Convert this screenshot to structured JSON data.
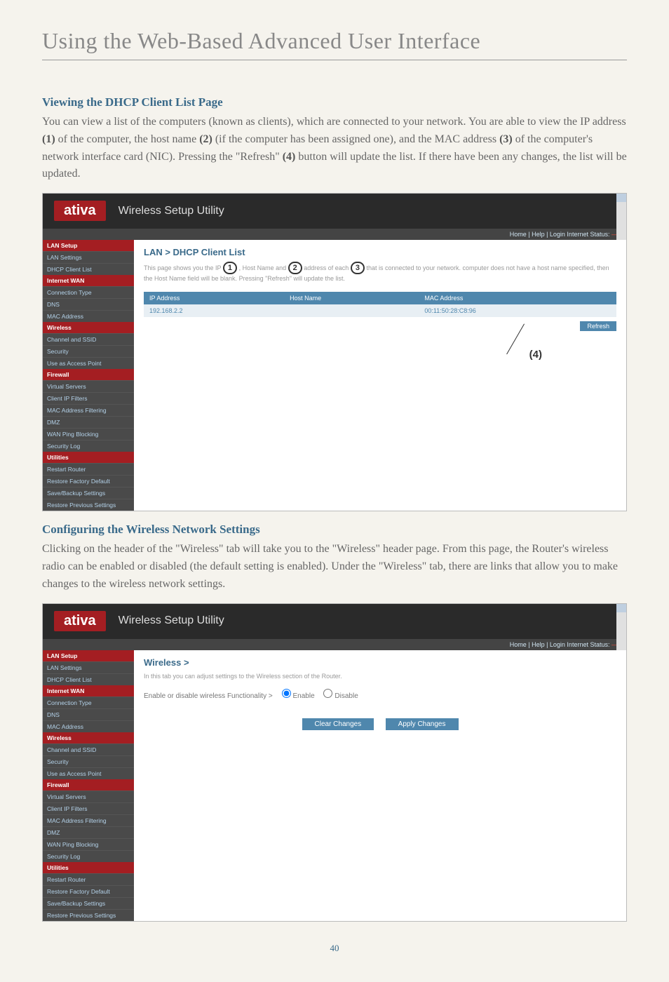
{
  "page_title": "Using the Web-Based Advanced User Interface",
  "section1": {
    "heading": "Viewing the DHCP Client List Page",
    "body_parts": [
      "You can view a list of the computers (known as clients), which are connected to your network. You are able to view the IP address ",
      "(1)",
      " of the computer, the host name ",
      "(2)",
      " (if the computer has been assigned one), and the MAC address ",
      "(3)",
      " of the computer's network interface card (NIC). Pressing the \"Refresh\" ",
      "(4)",
      " button will update the list. If there have been any changes, the list will be updated."
    ]
  },
  "screenshot1": {
    "brand": "ativa",
    "brand_sub": "Wireless Setup Utility",
    "meta": "Home | Help | Login  Internet Status:",
    "panel_title": "LAN > DHCP Client List",
    "panel_desc_a": "This page shows you the IP",
    "panel_desc_b": ", Host Name and",
    "panel_desc_c": "address of each",
    "panel_desc_d": "that is connected to your network.",
    "panel_desc_e": " computer does not have a host name specified, then the Host Name field will be blank. Pressing \"Refresh\" will update the list.",
    "table": {
      "headers": [
        "IP Address",
        "Host Name",
        "MAC Address"
      ],
      "row": [
        "192.168.2.2",
        "",
        "00:11:50:28:C8:96"
      ]
    },
    "refresh": "Refresh",
    "callout4": "(4)",
    "sidebar": {
      "groups": [
        {
          "head": "LAN Setup",
          "items": [
            "LAN Settings",
            "DHCP Client List"
          ]
        },
        {
          "head": "Internet WAN",
          "items": [
            "Connection Type",
            "DNS",
            "MAC Address"
          ]
        },
        {
          "head": "Wireless",
          "items": [
            "Channel and SSID",
            "Security",
            "Use as Access Point"
          ]
        },
        {
          "head": "Firewall",
          "items": [
            "Virtual Servers",
            "Client IP Filters",
            "MAC Address Filtering",
            "DMZ",
            "WAN Ping Blocking",
            "Security Log"
          ]
        },
        {
          "head": "Utilities",
          "items": [
            "Restart Router",
            "Restore Factory Default",
            "Save/Backup Settings",
            "Restore Previous Settings"
          ]
        }
      ]
    }
  },
  "section2": {
    "heading": "Configuring the Wireless Network Settings",
    "body": "Clicking on the header of the \"Wireless\" tab will take you to the \"Wireless\" header page. From this page, the Router's wireless radio can be enabled or disabled (the default setting is enabled). Under the \"Wireless\" tab, there are links that allow you to make changes to the wireless network settings."
  },
  "screenshot2": {
    "brand": "ativa",
    "brand_sub": "Wireless Setup Utility",
    "meta": "Home | Help | Login  Internet Status:",
    "panel_title": "Wireless >",
    "panel_desc": "In this tab you can adjust settings to the Wireless section of the Router.",
    "radio_label": "Enable or disable wireless Functionality >",
    "radio_enable": "Enable",
    "radio_disable": "Disable",
    "btn_clear": "Clear Changes",
    "btn_apply": "Apply Changes",
    "sidebar": {
      "groups": [
        {
          "head": "LAN Setup",
          "items": [
            "LAN Settings",
            "DHCP Client List"
          ]
        },
        {
          "head": "Internet WAN",
          "items": [
            "Connection Type",
            "DNS",
            "MAC Address"
          ]
        },
        {
          "head": "Wireless",
          "items": [
            "Channel and SSID",
            "Security",
            "Use as Access Point"
          ]
        },
        {
          "head": "Firewall",
          "items": [
            "Virtual Servers",
            "Client IP Filters",
            "MAC Address Filtering",
            "DMZ",
            "WAN Ping Blocking",
            "Security Log"
          ]
        },
        {
          "head": "Utilities",
          "items": [
            "Restart Router",
            "Restore Factory Default",
            "Save/Backup Settings",
            "Restore Previous Settings"
          ]
        }
      ]
    }
  },
  "page_number": "40"
}
